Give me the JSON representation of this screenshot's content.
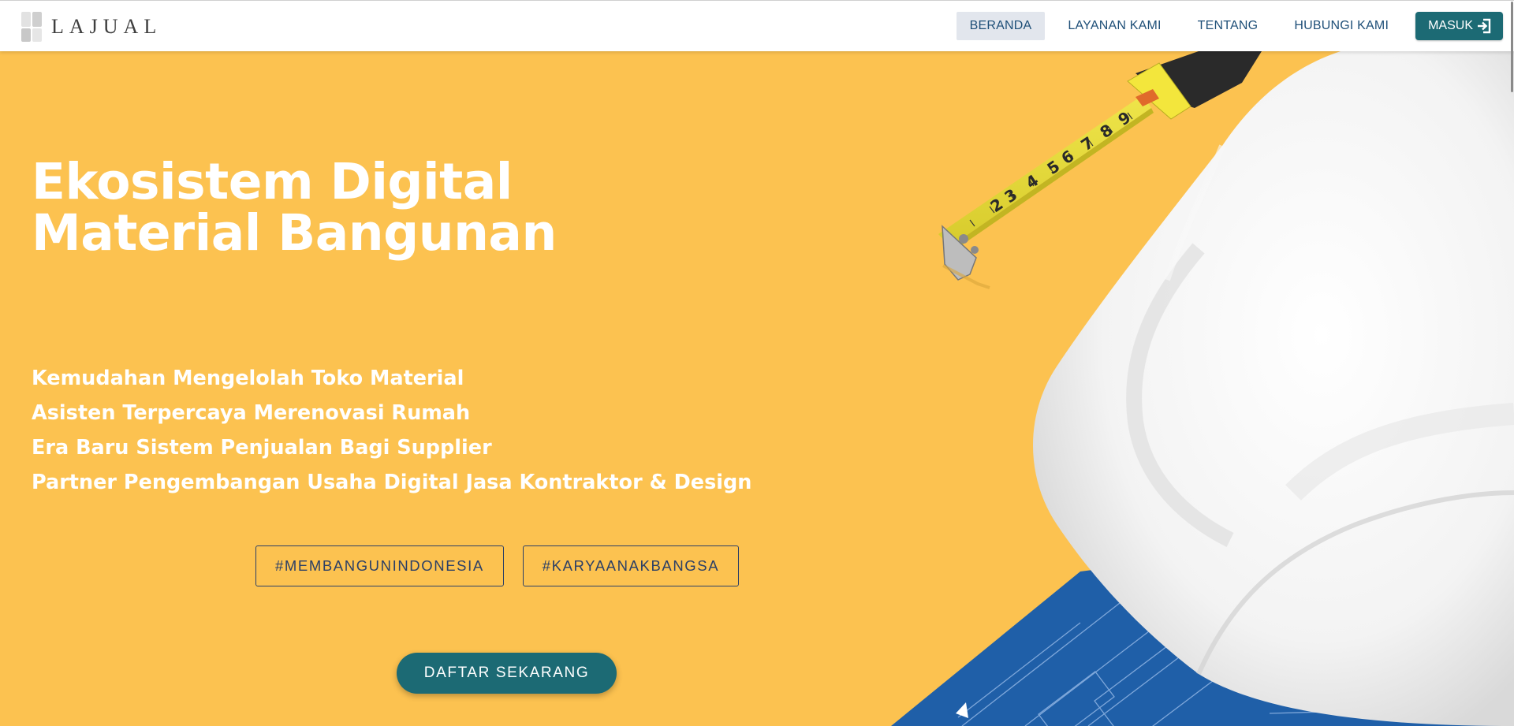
{
  "brand": {
    "name": "LAJUAL"
  },
  "nav": {
    "items": [
      {
        "label": "BERANDA",
        "active": true
      },
      {
        "label": "LAYANAN KAMI",
        "active": false
      },
      {
        "label": "TENTANG",
        "active": false
      },
      {
        "label": "HUBUNGI KAMI",
        "active": false
      }
    ],
    "login_label": "MASUK",
    "login_icon": "login-icon"
  },
  "hero": {
    "title": "Ekosistem Digital Material Bangunan",
    "taglines": [
      "Kemudahan Mengelolah Toko Material",
      "Asisten Terpercaya Merenovasi Rumah",
      "Era Baru Sistem Penjualan Bagi Supplier",
      "Partner Pengembangan Usaha Digital Jasa Kontraktor & Design"
    ],
    "hashtags": [
      "#MEMBANGUNINDONESIA",
      "#KARYAANAKBANGSA"
    ],
    "cta_label": "DAFTAR SEKARANG",
    "tape_numbers": [
      "2",
      "3",
      "4",
      "5",
      "6",
      "7",
      "8",
      "9"
    ]
  },
  "colors": {
    "hero_bg": "#fcc250",
    "primary": "#1c6a74",
    "nav_text": "#1e4f78",
    "hashtag_border": "#2b3f66",
    "blueprint": "#1f5fa8",
    "tape": "#e8df3a"
  }
}
